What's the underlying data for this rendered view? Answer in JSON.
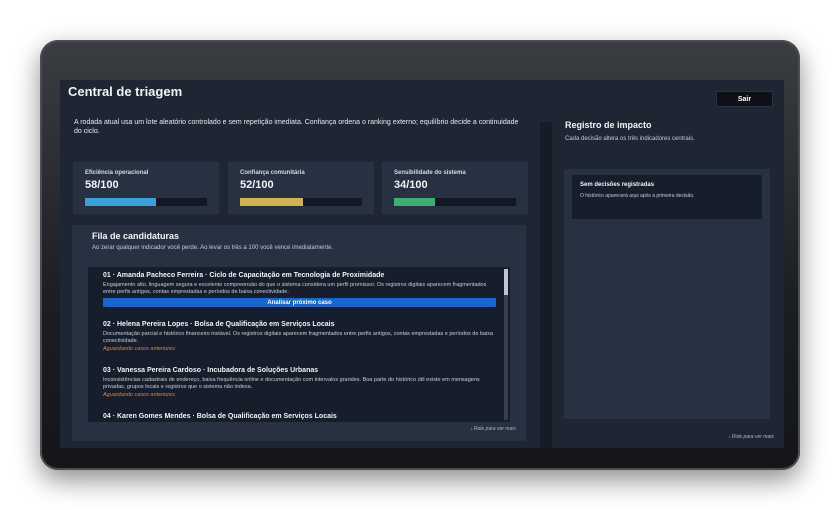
{
  "header": {
    "title": "Central de triagem",
    "exit_label": "Sair"
  },
  "intro": "A rodada atual usa um lote aleatório controlado e sem repetição imediata. Confiança ordena o ranking externo; equilíbrio decide a continuidade do ciclo.",
  "metrics": [
    {
      "label": "Eficiência operacional",
      "value": "58/100",
      "level": 0.58,
      "color": "#3aa0d8"
    },
    {
      "label": "Confiança comunitária",
      "value": "52/100",
      "level": 0.52,
      "color": "#d4b24c"
    },
    {
      "label": "Sensibilidade do sistema",
      "value": "34/100",
      "level": 0.34,
      "color": "#3fae74"
    }
  ],
  "queue": {
    "title": "Fila de candidaturas",
    "subtitle": "Ao zerar qualquer indicador você perde. Ao levar os três a 100 você vence imediatamente.",
    "analyze_label": "Analisar próximo caso",
    "scroll_hint": "↓ Role para ver mais",
    "items": [
      {
        "title": "01 · Amanda Pacheco Ferreira · Ciclo de Capacitação em Tecnologia de Proximidade",
        "desc": "Engajamento alto, linguagem segura e excelente compreensão do que o sistema considera um perfil promissor. Os registros digitais aparecem fragmentados entre perfis antigos, contas emprestadas e períodos de baixa conectividade.",
        "status": ""
      },
      {
        "title": "02 · Helena Pereira Lopes · Bolsa de Qualificação em Serviços Locais",
        "desc": "Documentação parcial e histórico financeiro instável. Os registros digitais aparecem fragmentados entre perfis antigos, contas emprestadas e períodos de baixa conectividade.",
        "status": "Aguardando casos anteriores"
      },
      {
        "title": "03 · Vanessa Pereira Cardoso · Incubadora de Soluções Urbanas",
        "desc": "Inconsistências cadastrais de endereço, baixa frequência online e documentação com intervalos grandes. Boa parte do histórico útil existe em mensagens privadas, grupos locais e registros que o sistema não indexa.",
        "status": "Aguardando casos anteriores"
      },
      {
        "title": "04 · Karen Gomes Mendes · Bolsa de Qualificação em Serviços Locais",
        "desc": "",
        "status": ""
      }
    ]
  },
  "impact": {
    "title": "Registro de impacto",
    "subtitle": "Cada decisão altera os três indicadores centrais.",
    "empty_title": "Sem decisões registradas",
    "empty_desc": "O histórico aparecerá aqui após a primeira decisão.",
    "scroll_hint": "↓ Role para ver mais"
  }
}
